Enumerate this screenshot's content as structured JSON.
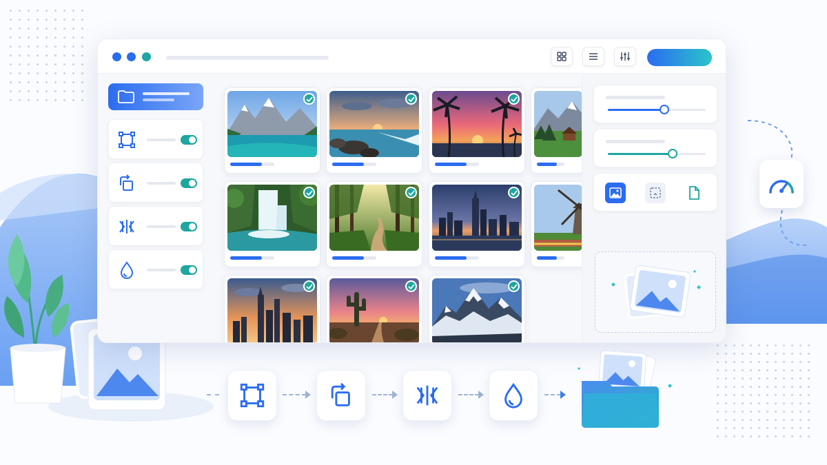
{
  "window": {
    "traffic_lights": [
      "#2b6cf0",
      "#2b6cf0",
      "#1ea6a0"
    ],
    "toolbar_buttons": [
      {
        "icon": "grid-view-icon"
      },
      {
        "icon": "list-view-icon"
      },
      {
        "icon": "adjustments-icon"
      }
    ]
  },
  "sidebar": {
    "folder_icon": "folder-icon",
    "tools": [
      {
        "icon": "crop-icon",
        "enabled": true
      },
      {
        "icon": "rotate-icon",
        "enabled": true
      },
      {
        "icon": "flip-icon",
        "enabled": true
      },
      {
        "icon": "watermark-drop-icon",
        "enabled": true
      }
    ]
  },
  "gallery": {
    "images": [
      {
        "scene": "mountain-lake",
        "selected": true,
        "progress": 0.72
      },
      {
        "scene": "rocky-beach-sunset",
        "selected": true,
        "progress": 0.72
      },
      {
        "scene": "palm-sunset",
        "selected": true,
        "progress": 0.72
      },
      {
        "scene": "alpine-village",
        "selected": false,
        "progress": 0.72
      },
      {
        "scene": "waterfall",
        "selected": true,
        "progress": 0.72
      },
      {
        "scene": "forest-path",
        "selected": true,
        "progress": 0.72
      },
      {
        "scene": "city-skyline-dusk",
        "selected": true,
        "progress": 0.72
      },
      {
        "scene": "windmill",
        "selected": false,
        "progress": 0.72
      },
      {
        "scene": "city-skyline-sunset",
        "selected": true,
        "progress": null
      },
      {
        "scene": "desert-cactus",
        "selected": true,
        "progress": null
      },
      {
        "scene": "snowy-mountains",
        "selected": true,
        "progress": null
      }
    ]
  },
  "settings_panel": {
    "sliders": [
      {
        "value": 0.58,
        "color": "#2b6cf0"
      },
      {
        "value": 0.66,
        "color": "#1ea6a0"
      }
    ],
    "formats": [
      {
        "icon": "image-format-icon",
        "active": true
      },
      {
        "icon": "selection-crop-icon",
        "active": false
      },
      {
        "icon": "document-icon",
        "active": false
      }
    ],
    "dropzone_icon": "image-stack-icon"
  },
  "pipeline": {
    "steps": [
      "crop-icon",
      "rotate-icon",
      "flip-icon",
      "watermark-drop-icon"
    ],
    "destination_icon": "folder-with-images-icon"
  },
  "floating": {
    "speed_icon": "speedometer-icon"
  },
  "colors": {
    "accent_blue": "#2b6cf0",
    "accent_teal": "#1ea6a0"
  }
}
